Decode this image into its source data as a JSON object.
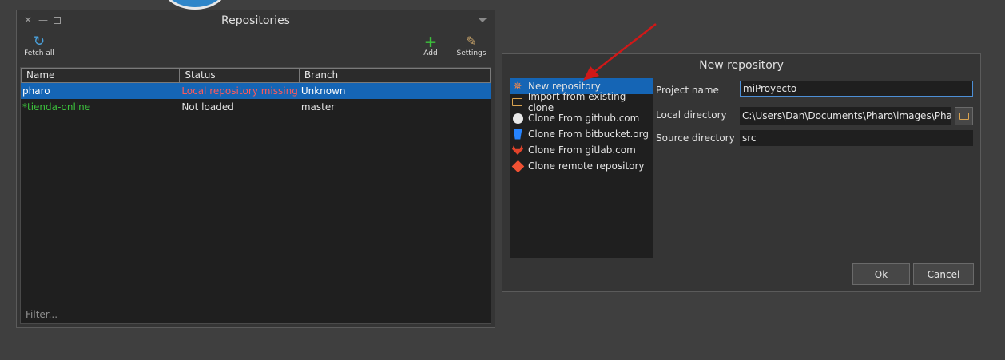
{
  "repositories_window": {
    "title": "Repositories",
    "toolbar": {
      "fetch_all": "Fetch all",
      "add": "Add",
      "settings": "Settings"
    },
    "columns": [
      "Name",
      "Status",
      "Branch"
    ],
    "rows": [
      {
        "name": "pharo",
        "status": "Local repository missing",
        "branch": "Unknown",
        "selected": true
      },
      {
        "name": "*tienda-online",
        "status": "Not loaded",
        "branch": "master",
        "selected": false
      }
    ],
    "filter_placeholder": "Filter..."
  },
  "new_repository_dialog": {
    "title": "New repository",
    "sources": [
      {
        "label": "New repository",
        "icon": "new-repository-icon"
      },
      {
        "label": "Import from existing clone",
        "icon": "folder-icon"
      },
      {
        "label": "Clone From github.com",
        "icon": "github-icon"
      },
      {
        "label": "Clone From bitbucket.org",
        "icon": "bitbucket-icon"
      },
      {
        "label": "Clone From gitlab.com",
        "icon": "gitlab-icon"
      },
      {
        "label": "Clone remote repository",
        "icon": "git-icon"
      }
    ],
    "form": {
      "project_name_label": "Project name",
      "project_name_value": "miProyecto",
      "local_directory_label": "Local directory",
      "local_directory_value": "C:\\Users\\Dan\\Documents\\Pharo\\images\\Pharo S",
      "source_directory_label": "Source directory",
      "source_directory_value": "src"
    },
    "buttons": {
      "ok": "Ok",
      "cancel": "Cancel"
    }
  },
  "colors": {
    "background": "#3f3f3f",
    "selection": "#1565b5",
    "status_missing": "#ff5a5a",
    "name_modified": "#3cc23c",
    "arrow": "#d01818"
  }
}
